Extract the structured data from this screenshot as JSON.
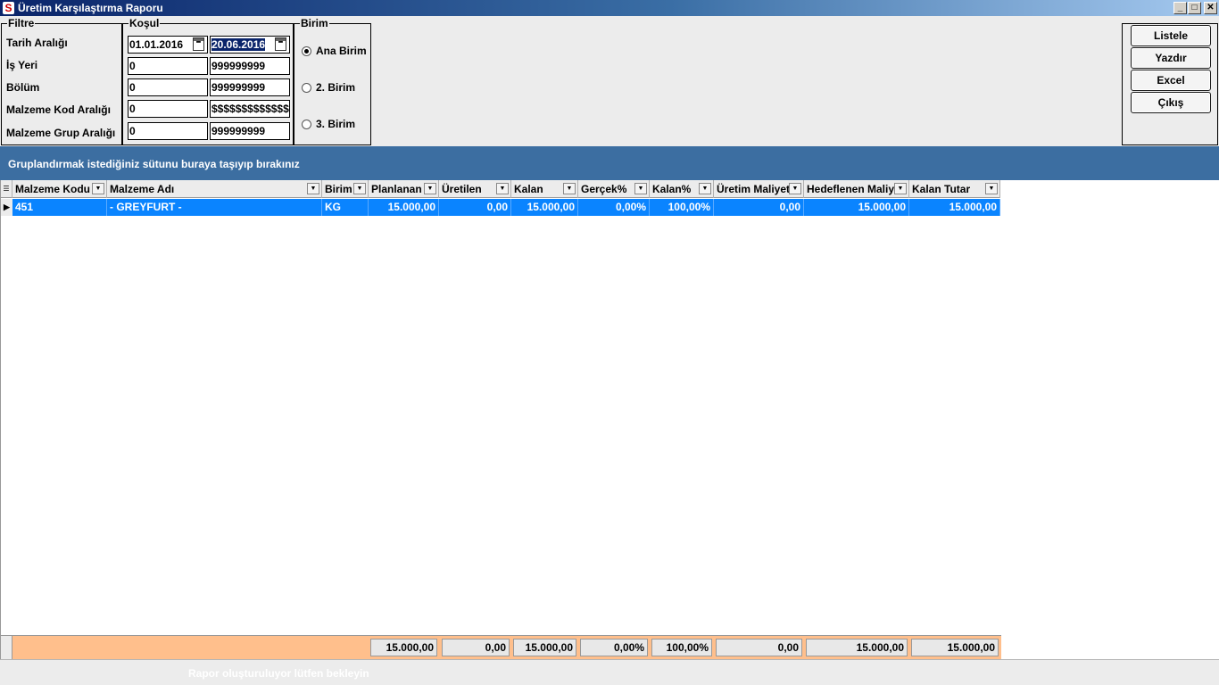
{
  "window": {
    "title": "Üretim Karşılaştırma Raporu",
    "app_icon": "S",
    "controls": {
      "minimize": "_",
      "maximize": "□",
      "close": "✕"
    }
  },
  "filter": {
    "legend": "Filtre",
    "labels": [
      "Tarih Aralığı",
      "İş Yeri",
      "Bölüm",
      "Malzeme Kod Aralığı",
      "Malzeme Grup Aralığı"
    ]
  },
  "kosul": {
    "legend": "Koşul",
    "date_from": "01.01.2016",
    "date_to": "20.06.2016",
    "isyeri_from": "0",
    "isyeri_to": "999999999",
    "bolum_from": "0",
    "bolum_to": "999999999",
    "kod_from": "0",
    "kod_to": "$$$$$$$$$$$$$$$",
    "grup_from": "0",
    "grup_to": "999999999"
  },
  "birim": {
    "legend": "Birim",
    "options": [
      "Ana Birim",
      "2. Birim",
      "3. Birim"
    ],
    "selected": "Ana Birim"
  },
  "actions": {
    "listele": "Listele",
    "yazdir": "Yazdır",
    "excel": "Excel",
    "cikis": "Çıkış"
  },
  "group_bar": {
    "text": "Gruplandırmak istediğiniz sütunu buraya taşıyıp bırakınız"
  },
  "grid": {
    "columns": [
      "Malzeme Kodu",
      "Malzeme Adı",
      "Birim",
      "Planlanan",
      "Üretilen",
      "Kalan",
      "Gerçek%",
      "Kalan%",
      "Üretim Maliyeti",
      "Hedeflenen Maliyet",
      "Kalan Tutar"
    ],
    "rows": [
      {
        "kod": "451",
        "ad": "- GREYFURT -",
        "birim": "KG",
        "planlanan": "15.000,00",
        "uretilen": "0,00",
        "kalan": "15.000,00",
        "gercek": "0,00%",
        "kalan_pct": "100,00%",
        "uretim_maliyeti": "0,00",
        "hedeflenen": "15.000,00",
        "kalan_tutar": "15.000,00"
      }
    ],
    "totals": {
      "planlanan": "15.000,00",
      "uretilen": "0,00",
      "kalan": "15.000,00",
      "gercek": "0,00%",
      "kalan_pct": "100,00%",
      "uretim_maliyeti": "0,00",
      "hedeflenen": "15.000,00",
      "kalan_tutar": "15.000,00"
    }
  },
  "status": {
    "message": "Rapor oluşturuluyor lütfen bekleyin"
  },
  "colors": {
    "title_bar": "#0a246a",
    "group_bar": "#3c6ea1",
    "selected_row": "#0a84ff",
    "footer": "#ffbf8c"
  }
}
